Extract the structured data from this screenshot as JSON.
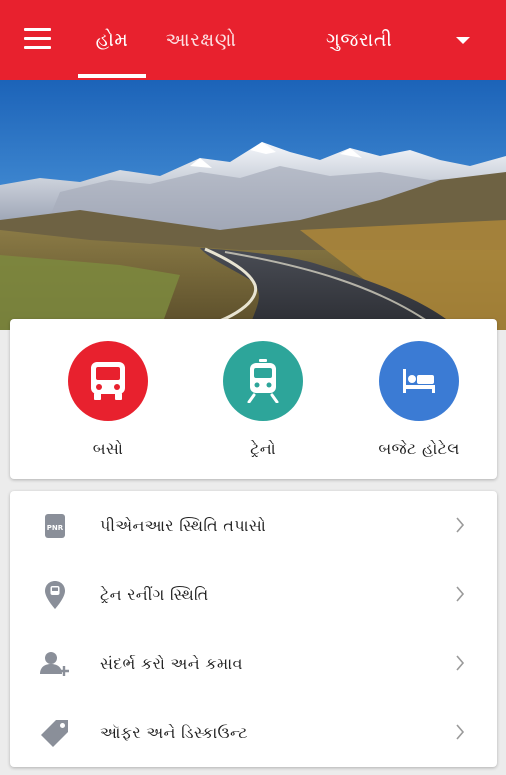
{
  "appbar": {
    "menu_icon": "hamburger-menu-icon",
    "tabs": [
      {
        "label": "હોમ",
        "active": true
      },
      {
        "label": "આરક્ષણો",
        "active": false
      }
    ],
    "language": "ગુજરાતી",
    "language_icon": "caret-down-icon",
    "color": "#e8212e"
  },
  "hero": {
    "image": "mountain-road-landscape"
  },
  "actions": [
    {
      "label": "બસો",
      "icon": "bus-icon",
      "color": "#e8212e"
    },
    {
      "label": "ટ્રેનો",
      "icon": "train-icon",
      "color": "#2da59a"
    },
    {
      "label": "બજેટ હોટેલ",
      "icon": "bed-icon",
      "color": "#3b7bd4"
    }
  ],
  "list": [
    {
      "label": "પીએનઆર સ્થિતિ તપાસો",
      "icon": "pnr-ticket-icon",
      "icon_text": "PNR"
    },
    {
      "label": "ટ્રેન રનીંગ સ્થિતિ",
      "icon": "location-pin-icon"
    },
    {
      "label": "સંદર્ભ કરો અને કમાવ",
      "icon": "add-person-icon"
    },
    {
      "label": "ઑફર અને ડિસ્કાઉન્ટ",
      "icon": "tag-icon"
    }
  ]
}
